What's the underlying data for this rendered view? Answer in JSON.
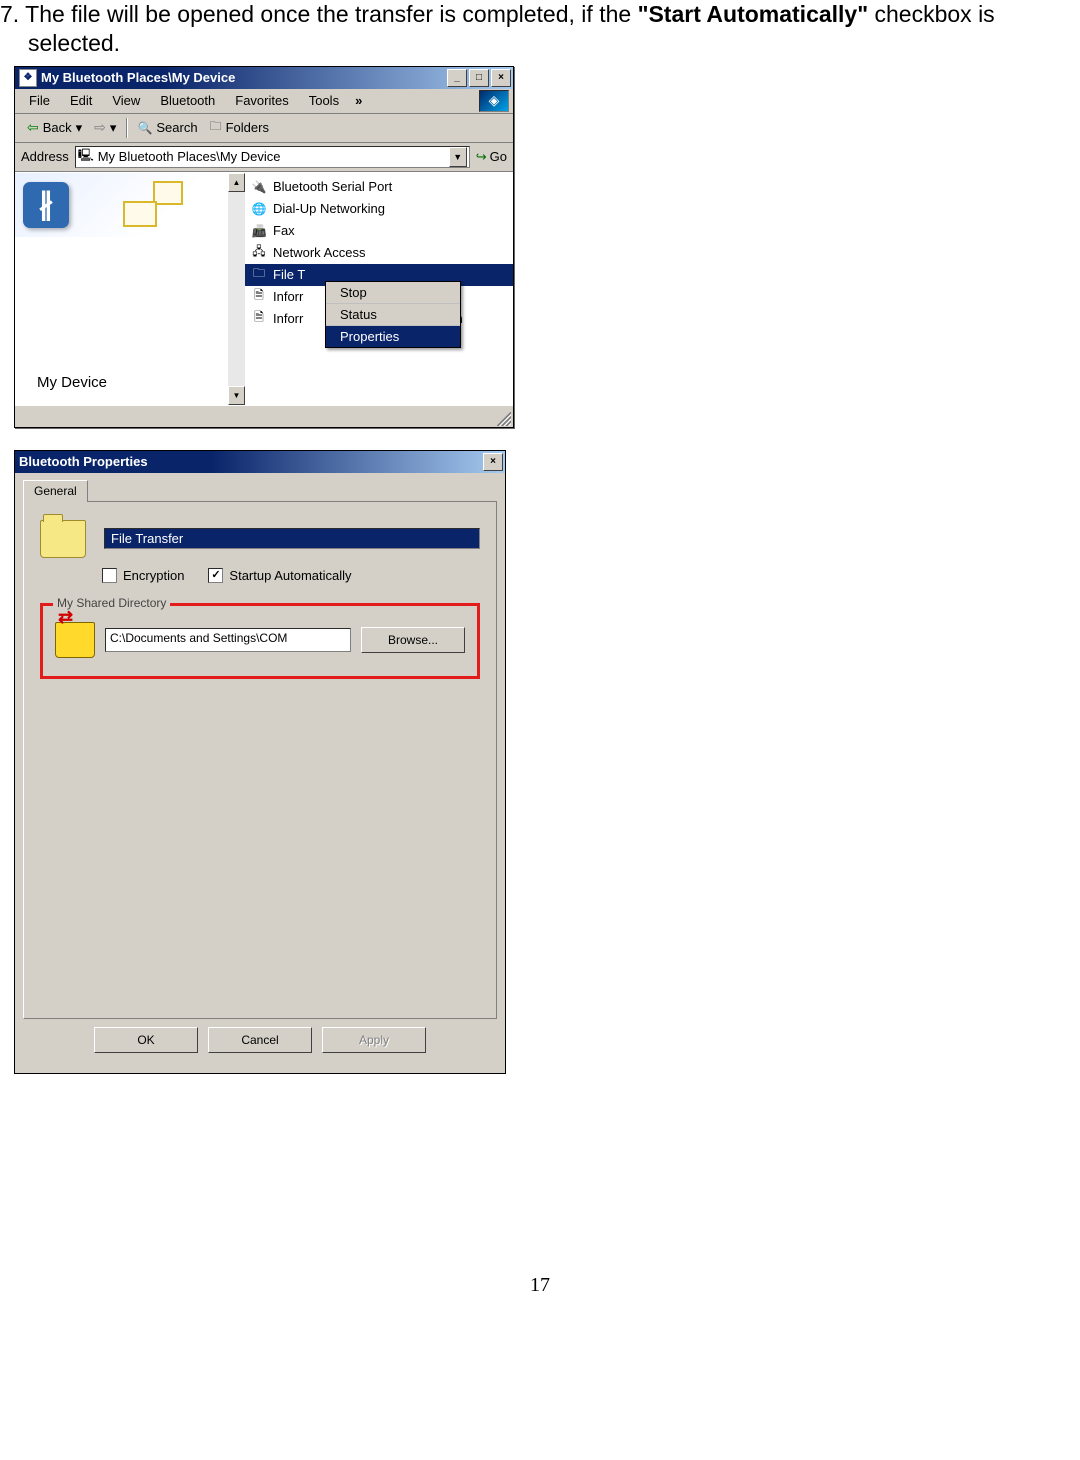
{
  "instruction": {
    "prefix": "7. The file will be opened once the transfer is completed, if the ",
    "bold": "\"Start Automatically\"",
    "suffix": " checkbox is selected."
  },
  "explorer": {
    "title": "My Bluetooth Places\\My Device",
    "titlebar_buttons": {
      "min": "_",
      "max": "□",
      "close": "×"
    },
    "menus": [
      "File",
      "Edit",
      "View",
      "Bluetooth",
      "Favorites",
      "Tools"
    ],
    "menus_more": "»",
    "toolbar": {
      "back": "Back",
      "back_dropdown": "▾",
      "search": "Search",
      "folders": "Folders"
    },
    "address_label": "Address",
    "address_value": "My Bluetooth Places\\My Device",
    "go_label": "Go",
    "left": {
      "device_label": "My Device"
    },
    "services": {
      "serial": "Bluetooth Serial Port",
      "dialup": "Dial-Up Networking",
      "fax": "Fax",
      "network": "Network Access",
      "file_transfer_prefix": "File T",
      "inforr1_prefix": "Inforr",
      "inforr2_prefix": "Inforr",
      "inforr2_suffix": "ion"
    },
    "context_menu": {
      "stop": "Stop",
      "status": "Status",
      "properties": "Properties"
    }
  },
  "dialog": {
    "title": "Bluetooth Properties",
    "close": "×",
    "tab": "General",
    "name_value": "File Transfer",
    "encryption_label": "Encryption",
    "startup_label": "Startup Automatically",
    "group_legend": "My Shared Directory",
    "path_value": "C:\\Documents and Settings\\COM",
    "browse": "Browse...",
    "ok": "OK",
    "cancel": "Cancel",
    "apply": "Apply"
  },
  "page_number": "17"
}
